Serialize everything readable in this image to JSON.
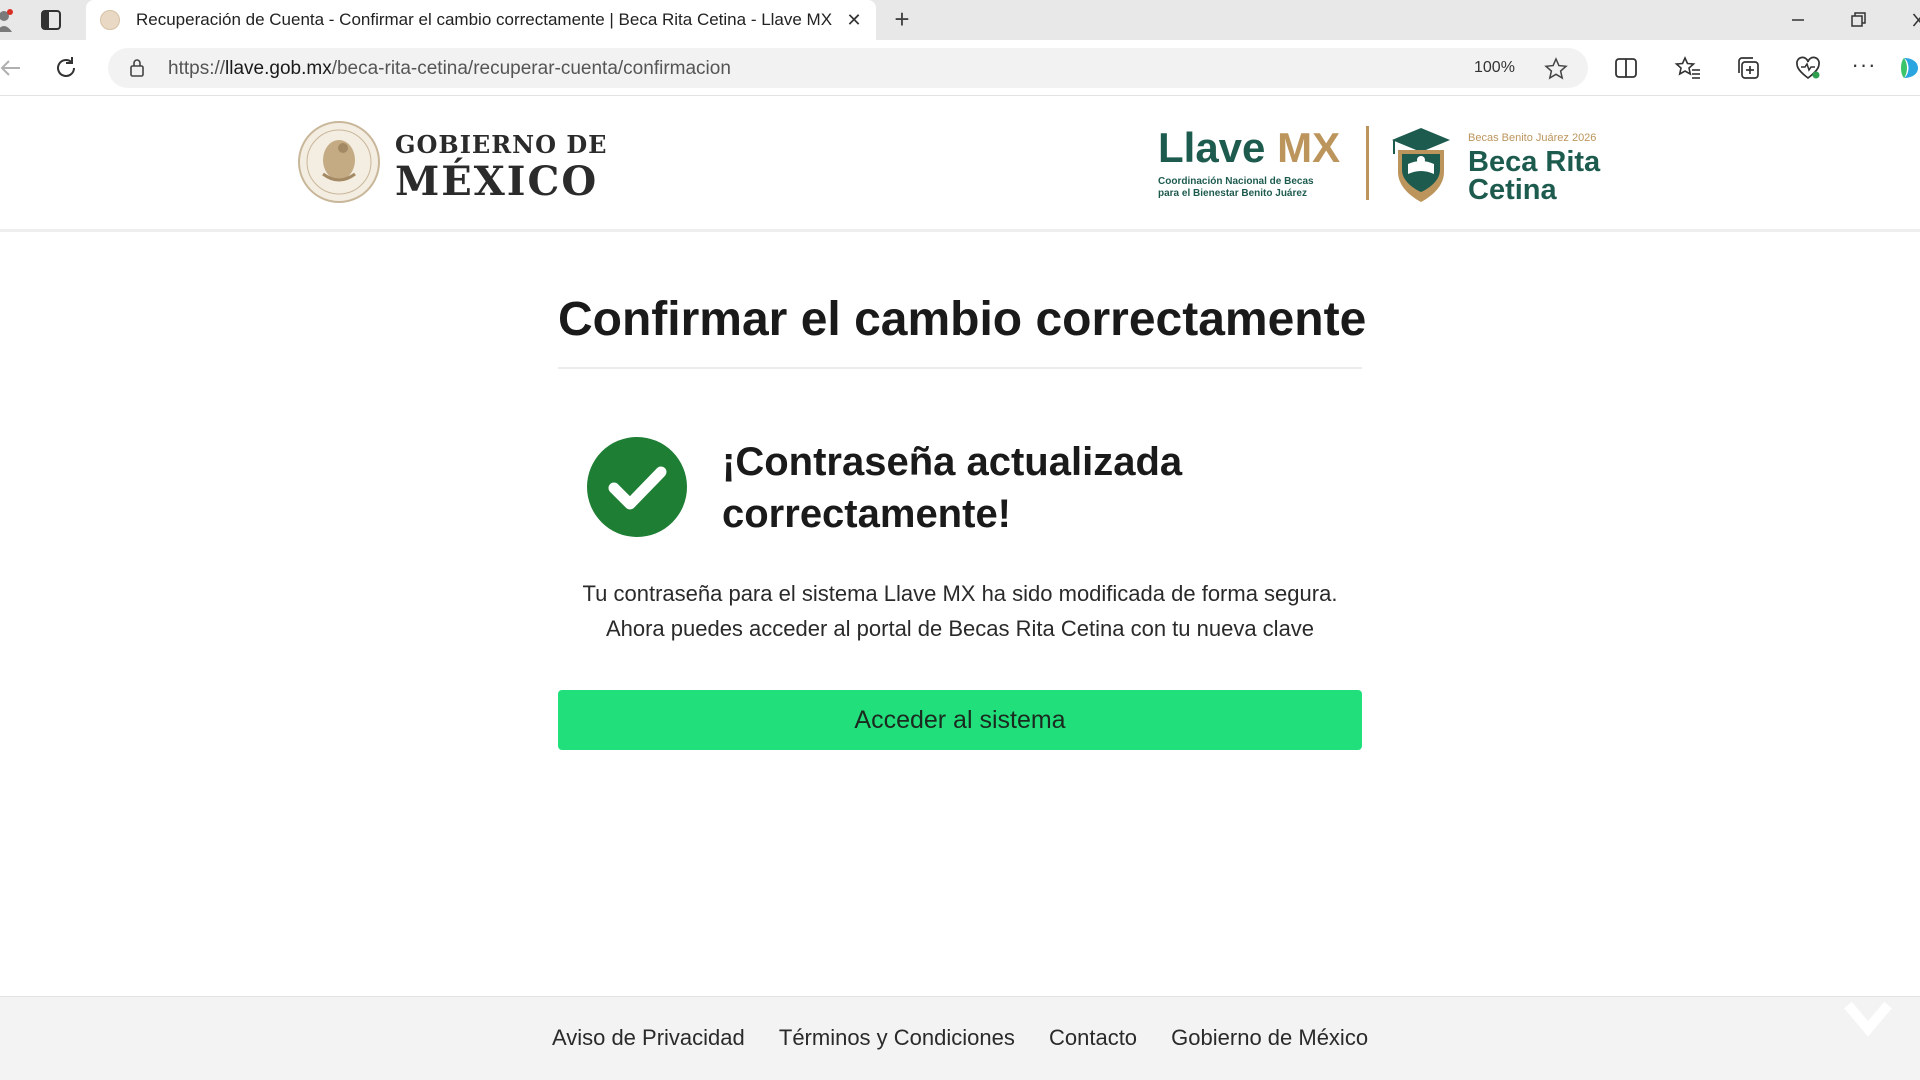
{
  "browser": {
    "tab": {
      "title": "Recuperación de Cuenta - Confirmar el cambio correctamente | Beca Rita Cetina - Llave MX",
      "close_glyph": "✕"
    },
    "new_tab_glyph": "+",
    "url": {
      "scheme": "https://",
      "host": "llave.gob.mx",
      "path": "/beca-rita-cetina/recuperar-cuenta/confirmacion"
    },
    "zoom": "100%",
    "more_glyph": "···"
  },
  "header": {
    "gobierno_line1": "GOBIERNO DE",
    "gobierno_line2": "MÉXICO",
    "llave_word_1": "Llave",
    "llave_word_2": "MX",
    "llave_sub_line1": "Coordinación Nacional de Becas",
    "llave_sub_line2": "para el Bienestar Benito Juárez",
    "beca_kicker": "Becas Benito Juárez 2026",
    "beca_name": "Beca Rita Cetina"
  },
  "main": {
    "title": "Confirmar el cambio correctamente",
    "success_heading": "¡Contraseña actualizada correctamente!",
    "message_line1": "Tu contraseña para el sistema Llave MX ha sido modificada de forma segura.",
    "message_line2": "Ahora puedes acceder al portal de Becas Rita Cetina con tu nueva clave",
    "button_label": "Acceder al sistema"
  },
  "footer": {
    "links": [
      "Aviso de Privacidad",
      "Términos y Condiciones",
      "Contacto",
      "Gobierno de México"
    ]
  },
  "colors": {
    "primary_green": "#1e5b4f",
    "gold": "#bc955c",
    "success_green": "#1e7e34",
    "button_green": "#21e07c"
  },
  "icons": {
    "success": "check-circle-icon",
    "seal": "mexico-seal-icon",
    "emblem": "graduation-shield-icon"
  }
}
